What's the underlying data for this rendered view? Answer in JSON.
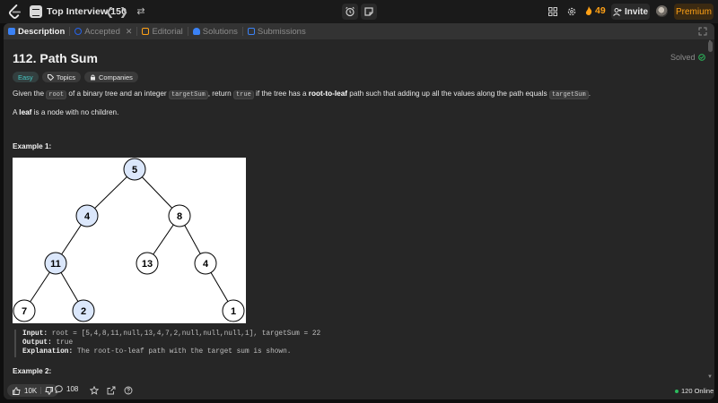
{
  "nav": {
    "title": "Top Interview 150",
    "streak_count": "49",
    "invite_label": "Invite",
    "premium_label": "Premium"
  },
  "tabs": [
    {
      "label": "Description",
      "active": true,
      "icon": "description-icon",
      "color": "#3b82f6"
    },
    {
      "label": "Accepted",
      "active": false,
      "icon": "accepted-icon",
      "color": "#2563eb",
      "closable": true
    },
    {
      "label": "Editorial",
      "active": false,
      "icon": "editorial-icon",
      "color": "#ffa116"
    },
    {
      "label": "Solutions",
      "active": false,
      "icon": "solutions-icon",
      "color": "#3b82f6"
    },
    {
      "label": "Submissions",
      "active": false,
      "icon": "submissions-icon",
      "color": "#3b82f6"
    }
  ],
  "problem": {
    "title": "112. Path Sum",
    "status": "Solved",
    "difficulty": "Easy",
    "topics_label": "Topics",
    "companies_label": "Companies",
    "desc_part1": "Given the ",
    "code_root": "root",
    "desc_part2": " of a binary tree and an integer ",
    "code_target": "targetSum",
    "desc_part3": ", return ",
    "code_true": "true",
    "desc_part4": " if the tree has a ",
    "desc_bold": "root-to-leaf",
    "desc_part5": " path such that adding up all the values along the path equals ",
    "code_target2": "targetSum",
    "desc_part6": ".",
    "leaf_bold": "leaf",
    "leaf_rest": " is a node with no children.",
    "leaf_prefix": "A "
  },
  "example1": {
    "label": "Example 1:",
    "input_label": "Input:",
    "input_value": " root = [5,4,8,11,null,13,4,7,2,null,null,null,1], targetSum = 22",
    "output_label": "Output:",
    "output_value": " true",
    "explanation_label": "Explanation:",
    "explanation_value": " The root-to-leaf path with the target sum is shown."
  },
  "example2": {
    "label": "Example 2:"
  },
  "tree": {
    "nodes": [
      {
        "id": "n5",
        "value": "5",
        "highlighted": true
      },
      {
        "id": "n4a",
        "value": "4",
        "highlighted": true
      },
      {
        "id": "n8",
        "value": "8",
        "highlighted": false
      },
      {
        "id": "n11",
        "value": "11",
        "highlighted": true
      },
      {
        "id": "n13",
        "value": "13",
        "highlighted": false
      },
      {
        "id": "n4b",
        "value": "4",
        "highlighted": false
      },
      {
        "id": "n7",
        "value": "7",
        "highlighted": false
      },
      {
        "id": "n2",
        "value": "2",
        "highlighted": true
      },
      {
        "id": "n1",
        "value": "1",
        "highlighted": false
      }
    ],
    "highlight_color": "#dbe7fb"
  },
  "footer": {
    "likes": "10K",
    "comments": "108",
    "online": "120 Online"
  }
}
